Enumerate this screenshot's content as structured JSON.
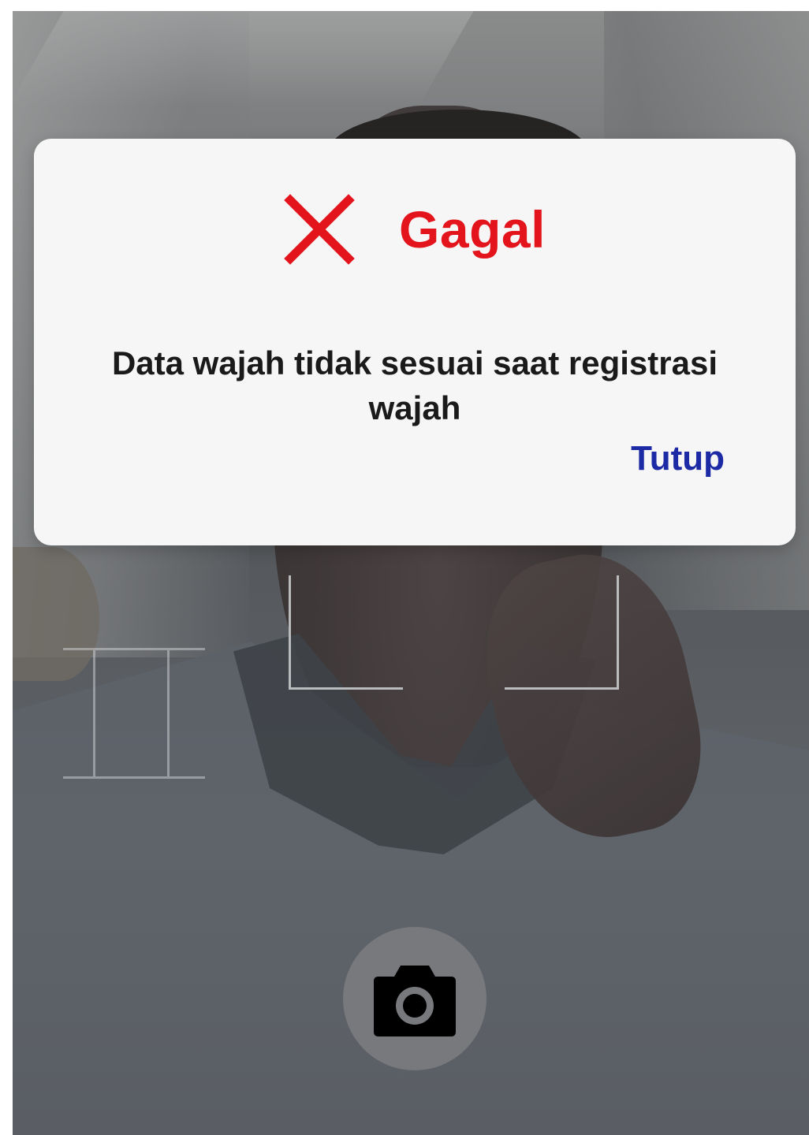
{
  "dialog": {
    "icon": "close-x-icon",
    "title": "Gagal",
    "message": "Data wajah tidak sesuai saat registrasi wajah",
    "close_label": "Tutup"
  },
  "camera": {
    "shutter_icon": "camera-icon"
  },
  "colors": {
    "error_red": "#e3141b",
    "action_blue": "#1c2aa6",
    "dialog_bg": "#f6f6f6",
    "shutter_bg": "#77797c"
  }
}
